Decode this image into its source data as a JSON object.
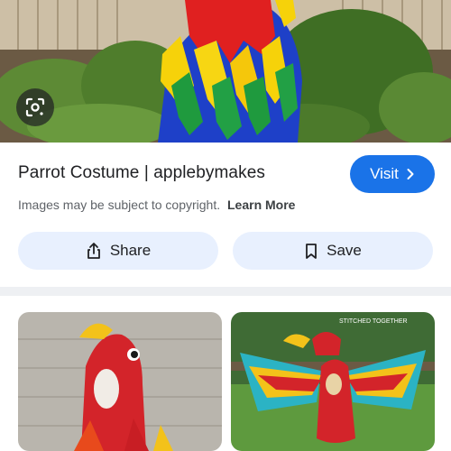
{
  "result": {
    "title": "Parrot Costume | applebymakes",
    "visit_label": "Visit",
    "copyright_text": "Images may be subject to copyright.",
    "learn_more_label": "Learn More"
  },
  "actions": {
    "share_label": "Share",
    "save_label": "Save"
  },
  "related": [
    {
      "watermark": ""
    },
    {
      "watermark": "STITCHED TOGETHER"
    }
  ],
  "colors": {
    "accent": "#1a73e8",
    "button_bg": "#e8f0fe",
    "muted_text": "#5f6368"
  },
  "icons": [
    "lens-icon",
    "chevron-right-icon",
    "share-icon",
    "bookmark-icon"
  ]
}
